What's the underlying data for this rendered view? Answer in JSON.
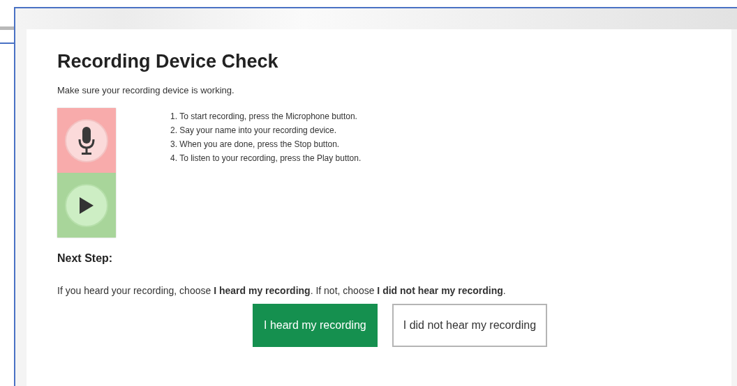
{
  "title": "Recording Device Check",
  "subtitle": "Make sure your recording device is working.",
  "controls": [
    {
      "kind": "microphone"
    },
    {
      "kind": "play"
    }
  ],
  "instructions": [
    "1. To start recording, press the Microphone button.",
    "2. Say your name into your recording device.",
    "3. When you are done, press the Stop button.",
    "4. To listen to your recording, press the Play button."
  ],
  "next_step": {
    "heading": "Next Step:",
    "text": "If you heard your recording, choose **I heard my recording**. If not, choose **I did not hear my recording**."
  },
  "buttons": [
    {
      "label": "I heard my recording",
      "kind": "primary"
    },
    {
      "label": "I did not hear my recording",
      "kind": "secondary"
    }
  ]
}
